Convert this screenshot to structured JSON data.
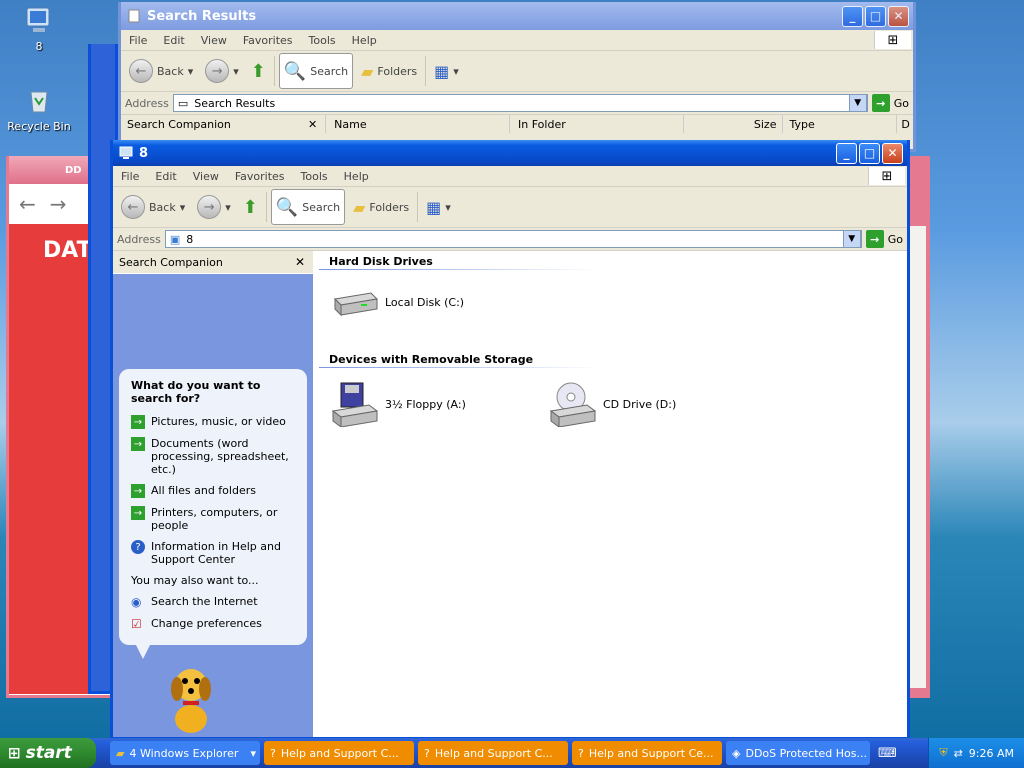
{
  "desktop": {
    "icons": [
      {
        "label": "8"
      },
      {
        "label": "Recycle Bin"
      }
    ]
  },
  "bg_windows": {
    "search_results": {
      "title": "Search Results",
      "menu": [
        "File",
        "Edit",
        "View",
        "Favorites",
        "Tools",
        "Help"
      ],
      "toolbar": {
        "back": "Back",
        "search": "Search",
        "folders": "Folders"
      },
      "address_label": "Address",
      "address_value": "Search Results",
      "go": "Go",
      "pane_title": "Search Companion",
      "columns": [
        "Name",
        "In Folder",
        "Size",
        "Type",
        "D"
      ]
    },
    "red_window_text": "DAT",
    "red_window_tab": "DD"
  },
  "main_window": {
    "title": "8",
    "menu": [
      "File",
      "Edit",
      "View",
      "Favorites",
      "Tools",
      "Help"
    ],
    "toolbar": {
      "back": "Back",
      "search": "Search",
      "folders": "Folders"
    },
    "address_label": "Address",
    "address_value": "8",
    "go": "Go",
    "pane_title": "Search Companion",
    "search_panel": {
      "question": "What do you want to search for?",
      "options": [
        "Pictures, music, or video",
        "Documents (word processing, spreadsheet, etc.)",
        "All files and folders",
        "Printers, computers, or people",
        "Information in Help and Support Center"
      ],
      "also_label": "You may also want to...",
      "also_options": [
        "Search the Internet",
        "Change preferences"
      ]
    },
    "groups": [
      {
        "title": "Hard Disk Drives",
        "items": [
          {
            "label": "Local Disk (C:)",
            "icon": "hard-disk-icon"
          }
        ]
      },
      {
        "title": "Devices with Removable Storage",
        "items": [
          {
            "label": "3½ Floppy (A:)",
            "icon": "floppy-drive-icon"
          },
          {
            "label": "CD Drive (D:)",
            "icon": "cd-drive-icon"
          }
        ]
      }
    ]
  },
  "taskbar": {
    "start_label": "start",
    "tasks": [
      {
        "label": "4 Windows Explorer",
        "color": "#3c81f3"
      },
      {
        "label": "Help and Support C...",
        "color": "#f08c00"
      },
      {
        "label": "Help and Support C...",
        "color": "#f08c00"
      },
      {
        "label": "Help and Support Ce...",
        "color": "#f08c00"
      },
      {
        "label": "DDoS Protected Hos...",
        "color": "#3c81f3"
      }
    ],
    "clock": "9:26 AM"
  },
  "colors": {
    "accent": "#0a4fd8",
    "task_orange": "#f08c00",
    "start_green": "#2f8a2f"
  }
}
